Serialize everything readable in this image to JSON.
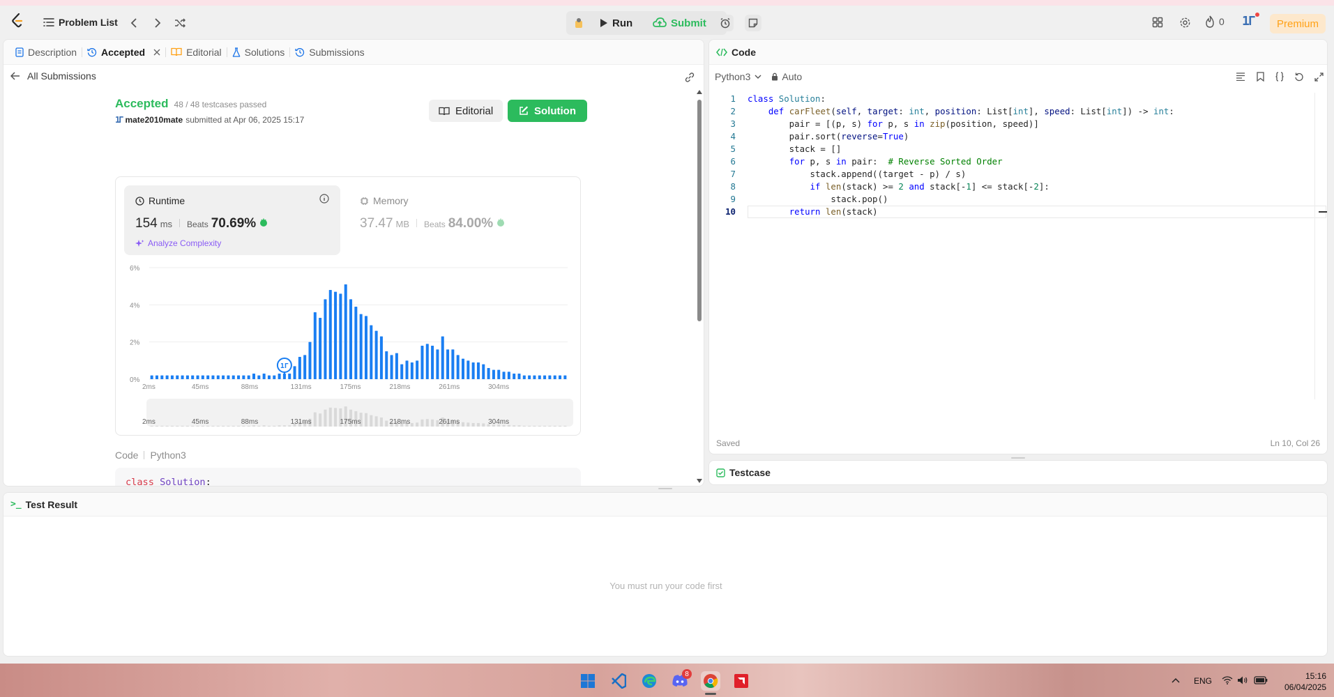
{
  "topbar": {
    "problem_list": "Problem List",
    "run": "Run",
    "submit": "Submit",
    "streak_count": "0",
    "premium": "Premium"
  },
  "left_tabs": {
    "description": "Description",
    "accepted": "Accepted",
    "editorial": "Editorial",
    "solutions": "Solutions",
    "submissions": "Submissions"
  },
  "submission": {
    "back_label": "All Submissions",
    "status": "Accepted",
    "testcases": "48 / 48 testcases passed",
    "user": "mate2010mate",
    "submitted_at": "submitted at Apr 06, 2025 15:17",
    "editorial_btn": "Editorial",
    "solution_btn": "Solution",
    "runtime_label": "Runtime",
    "runtime_value": "154",
    "runtime_unit": "ms",
    "beats_label": "Beats",
    "runtime_beats": "70.69%",
    "analyze": "Analyze Complexity",
    "memory_label": "Memory",
    "memory_value": "37.47",
    "memory_unit": "MB",
    "memory_beats": "84.00%",
    "code_label": "Code",
    "code_lang": "Python3"
  },
  "chart_data": {
    "type": "bar",
    "y_ticks": [
      "6%",
      "4%",
      "2%",
      "0%"
    ],
    "ylim": [
      0,
      6
    ],
    "x_ticks": [
      "2ms",
      "45ms",
      "88ms",
      "131ms",
      "175ms",
      "218ms",
      "261ms",
      "304ms"
    ],
    "highlight_index": 26,
    "values": [
      0.2,
      0.2,
      0.2,
      0.2,
      0.2,
      0.2,
      0.2,
      0.2,
      0.2,
      0.2,
      0.2,
      0.2,
      0.2,
      0.2,
      0.2,
      0.2,
      0.2,
      0.2,
      0.2,
      0.2,
      0.3,
      0.2,
      0.3,
      0.2,
      0.2,
      0.3,
      0.3,
      0.3,
      0.7,
      1.2,
      1.3,
      2.0,
      3.6,
      3.3,
      4.3,
      4.8,
      4.7,
      4.6,
      5.1,
      4.3,
      3.9,
      3.5,
      3.4,
      2.9,
      2.6,
      2.3,
      1.5,
      1.3,
      1.4,
      0.8,
      1.0,
      0.9,
      1.0,
      1.8,
      1.9,
      1.8,
      1.6,
      2.3,
      1.6,
      1.6,
      1.3,
      1.1,
      1.0,
      0.9,
      0.9,
      0.8,
      0.6,
      0.5,
      0.5,
      0.4,
      0.4,
      0.3,
      0.3,
      0.2,
      0.2,
      0.2,
      0.2,
      0.2,
      0.2,
      0.2,
      0.2,
      0.2
    ]
  },
  "submitted_code": [
    "class Solution:",
    "    def carFleet(self, target: int, position: List[int], speed: List[int]) -> int",
    "        pair = [(p, s) for p, s in zip(position, speed)]",
    "        pair.sort(reverse=True)"
  ],
  "editor": {
    "title": "Code",
    "language": "Python3",
    "mode": "Auto",
    "saved": "Saved",
    "cursor": "Ln 10, Col 26",
    "lines": [
      "class Solution:",
      "    def carFleet(self, target: int, position: List[int], speed: List[int]) -> int:",
      "        pair = [(p, s) for p, s in zip(position, speed)]",
      "        pair.sort(reverse=True)",
      "        stack = []",
      "        for p, s in pair:  # Reverse Sorted Order",
      "            stack.append((target - p) / s)",
      "            if len(stack) >= 2 and stack[-1] <= stack[-2]:",
      "                stack.pop()",
      "        return len(stack)"
    ],
    "line_numbers": [
      "1",
      "2",
      "3",
      "4",
      "5",
      "6",
      "7",
      "8",
      "9",
      "10"
    ]
  },
  "testcase": {
    "title": "Testcase"
  },
  "test_result": {
    "title": "Test Result",
    "empty_message": "You must run your code first"
  },
  "taskbar": {
    "lang": "ENG",
    "time": "15:16",
    "date": "06/04/2025",
    "discord_badge": "8"
  }
}
